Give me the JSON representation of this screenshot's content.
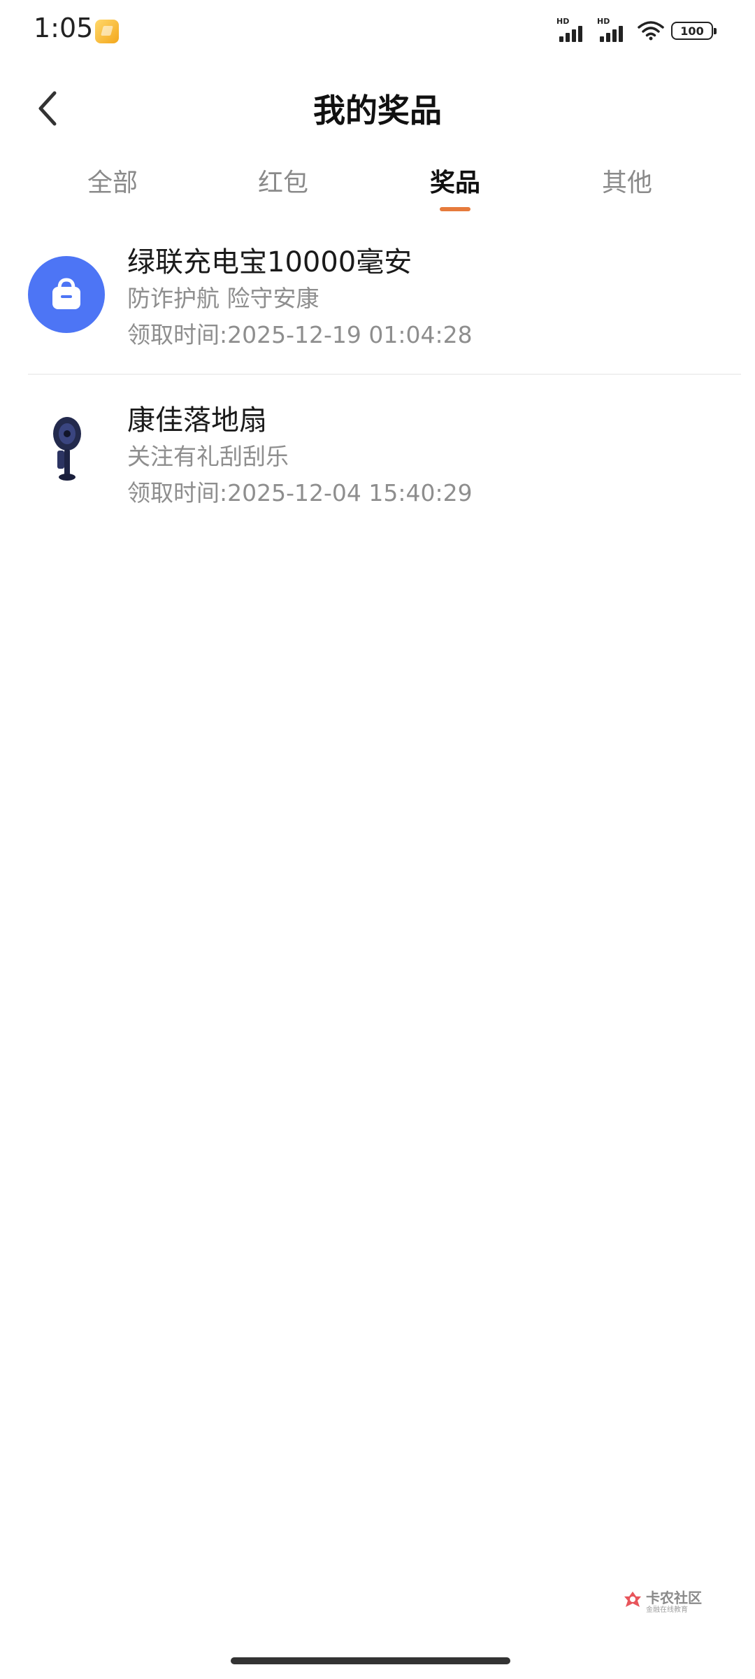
{
  "status_bar": {
    "time": "1:05",
    "signal_1_label": "HD",
    "signal_2_label": "HD",
    "battery": "100",
    "icons": [
      "note-icon",
      "signal-icon",
      "signal-icon",
      "wifi-icon",
      "battery-icon"
    ]
  },
  "header": {
    "title": "我的奖品",
    "back_icon": "chevron-left-icon"
  },
  "tabs": [
    {
      "label": "全部",
      "active": false
    },
    {
      "label": "红包",
      "active": false
    },
    {
      "label": "奖品",
      "active": true
    },
    {
      "label": "其他",
      "active": false
    }
  ],
  "colors": {
    "accent": "#e67b3c",
    "bag_icon_bg": "#4d75f5",
    "secondary_text": "#8e8e8e"
  },
  "prizes": [
    {
      "name": "绿联充电宝10000毫安",
      "desc": "防诈护航 险守安康",
      "time": "领取时间:2025-12-19 01:04:28",
      "icon": "shopping-bag-icon"
    },
    {
      "name": "康佳落地扇",
      "desc": "关注有礼刮刮乐",
      "time": "领取时间:2025-12-04 15:40:29",
      "icon": "floor-fan-icon"
    }
  ],
  "watermark": {
    "name": "卡农社区",
    "sub": "金融在线教育"
  }
}
